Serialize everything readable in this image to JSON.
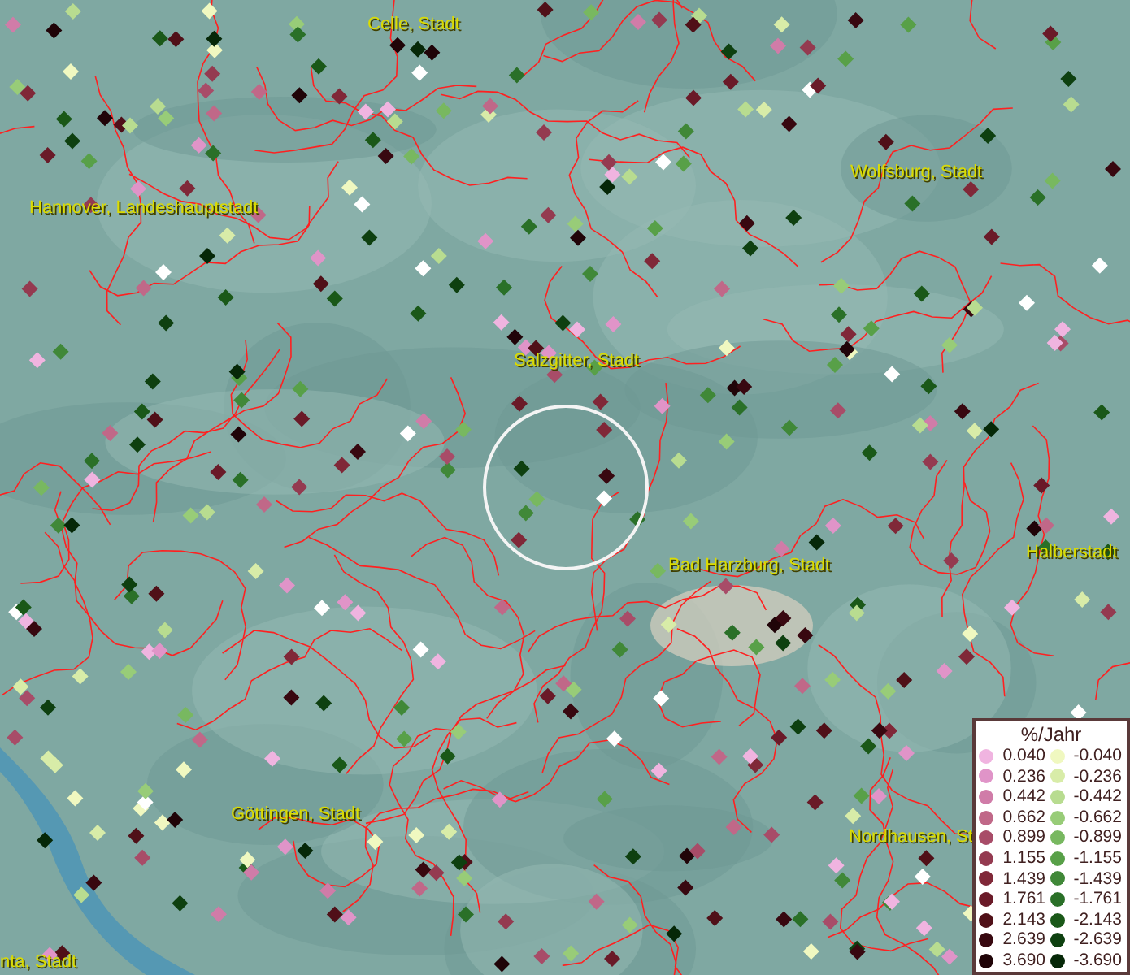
{
  "map": {
    "city_labels": [
      {
        "text": "Celle, Stadt"
      },
      {
        "text": "Hannover, Landeshauptstadt"
      },
      {
        "text": "Wolfsburg, Stadt"
      },
      {
        "text": "Salzgitter, Stadt"
      },
      {
        "text": "Bad Harzburg, Stadt"
      },
      {
        "text": "Halberstadt"
      },
      {
        "text": "Göttingen, Stadt"
      },
      {
        "text": "Nordhausen, St"
      },
      {
        "text": "nta, Stadt"
      }
    ]
  },
  "legend": {
    "title": "%/Jahr",
    "rows": [
      {
        "positive": {
          "value": "0.040",
          "color": "#f0b4e0"
        },
        "negative": {
          "value": "-0.040",
          "color": "#f0f8c0"
        }
      },
      {
        "positive": {
          "value": "0.236",
          "color": "#e094c8"
        },
        "negative": {
          "value": "-0.236",
          "color": "#d8eca8"
        }
      },
      {
        "positive": {
          "value": "0.442",
          "color": "#d07ca8"
        },
        "negative": {
          "value": "-0.442",
          "color": "#b8dc90"
        }
      },
      {
        "positive": {
          "value": "0.662",
          "color": "#c06888"
        },
        "negative": {
          "value": "-0.662",
          "color": "#98cc78"
        }
      },
      {
        "positive": {
          "value": "0.899",
          "color": "#a84c68"
        },
        "negative": {
          "value": "-0.899",
          "color": "#78b860"
        }
      },
      {
        "positive": {
          "value": "1.155",
          "color": "#943a50"
        },
        "negative": {
          "value": "-1.155",
          "color": "#58a048"
        }
      },
      {
        "positive": {
          "value": "1.439",
          "color": "#802838"
        },
        "negative": {
          "value": "-1.439",
          "color": "#408838"
        }
      },
      {
        "positive": {
          "value": "1.761",
          "color": "#6a1a28"
        },
        "negative": {
          "value": "-1.761",
          "color": "#2a7028"
        }
      },
      {
        "positive": {
          "value": "2.143",
          "color": "#501018"
        },
        "negative": {
          "value": "-2.143",
          "color": "#1a5818"
        }
      },
      {
        "positive": {
          "value": "2.639",
          "color": "#380810"
        },
        "negative": {
          "value": "-2.639",
          "color": "#0e4010"
        }
      },
      {
        "positive": {
          "value": "3.690",
          "color": "#200408"
        },
        "negative": {
          "value": "-3.690",
          "color": "#062808"
        }
      }
    ]
  }
}
